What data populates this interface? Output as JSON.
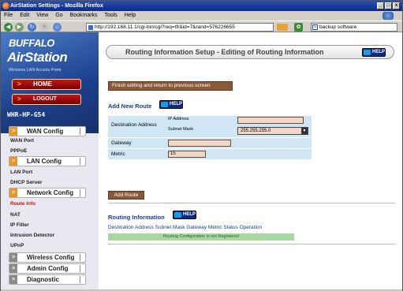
{
  "window": {
    "title": "AirStation Settings - Mozilla Firefox",
    "controls": [
      "_",
      "□",
      "x"
    ]
  },
  "menubar": [
    "File",
    "Edit",
    "View",
    "Go",
    "Bookmarks",
    "Tools",
    "Help"
  ],
  "navbar": {
    "url": "http://192.168.11.1/cgi-bin/cgi?req=tfr&id=7&rand=576226655",
    "search": "backup software",
    "search_engine_glyph": "G"
  },
  "sidebar": {
    "brand": "BUFFALO",
    "product": "AirStation",
    "tagline": "Wireless LAN Access Point",
    "home_label": "HOME",
    "logout_label": "LOGOUT",
    "device_name": "WHR-HP-G54",
    "groups": [
      {
        "label": "WAN Config",
        "items": [
          "WAN Port",
          "PPPoE"
        ]
      },
      {
        "label": "LAN Config",
        "items": [
          "LAN Port",
          "DHCP Server"
        ]
      },
      {
        "label": "Network Config",
        "items": [
          "Route Info",
          "NAT",
          "IP Filter",
          "Intrusion Detector",
          "UPnP"
        ]
      },
      {
        "label": "Wireless Config",
        "items": []
      },
      {
        "label": "Admin Config",
        "items": []
      },
      {
        "label": "Diagnostic",
        "items": []
      }
    ],
    "active_item": "Route Info"
  },
  "main": {
    "page_title": "Routing Information Setup - Editing of Routing Information",
    "help_label": "HELP",
    "finish_button": "Finish editing and return to previous screen",
    "add_route": {
      "title": "Add New Route",
      "destination_label": "Destination Address",
      "ip_address_label": "IP Address",
      "subnet_mask_label": "Subnet Mask",
      "ip_address_value": "",
      "subnet_mask_value": "255.255.255.0",
      "gateway_label": "Gateway",
      "gateway_value": "",
      "metric_label": "Metric",
      "metric_value": "15",
      "add_button": "Add Route"
    },
    "routing_info": {
      "title": "Routing Information",
      "columns": [
        "Destination Address",
        "Subnet Mask",
        "Gateway",
        "Metric",
        "Status",
        "Operation"
      ],
      "empty_message": "Routing Configuration is not Registered"
    }
  }
}
